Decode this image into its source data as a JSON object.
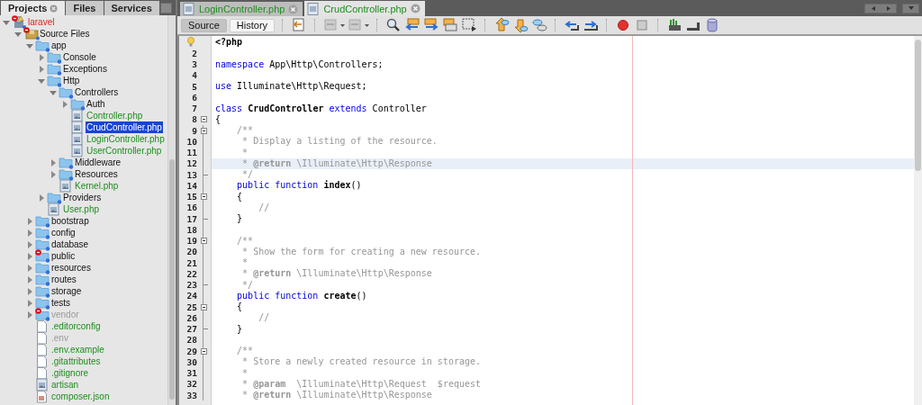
{
  "projects_panel": {
    "tabs": [
      {
        "label": "Projects",
        "selected": true
      },
      {
        "label": "Files",
        "selected": false
      },
      {
        "label": "Services",
        "selected": false
      }
    ],
    "tree": [
      {
        "label": "laravel",
        "kind": "project",
        "expanded": true,
        "error": true,
        "selected": false,
        "children": [
          {
            "label": "Source Files",
            "kind": "package",
            "expanded": true,
            "error": true,
            "added": false,
            "ignored": false,
            "selected": false,
            "children": [
              {
                "label": "app",
                "kind": "folder",
                "expanded": true,
                "error": false,
                "added": false,
                "ignored": false,
                "selected": false,
                "children": [
                  {
                    "label": "Console",
                    "kind": "folder",
                    "expanded": false,
                    "error": false,
                    "added": false,
                    "ignored": false,
                    "selected": false
                  },
                  {
                    "label": "Exceptions",
                    "kind": "folder",
                    "expanded": false,
                    "error": false,
                    "added": false,
                    "ignored": false,
                    "selected": false
                  },
                  {
                    "label": "Http",
                    "kind": "folder",
                    "expanded": true,
                    "error": false,
                    "added": false,
                    "ignored": false,
                    "selected": false,
                    "children": [
                      {
                        "label": "Controllers",
                        "kind": "folder",
                        "expanded": true,
                        "error": false,
                        "added": false,
                        "ignored": false,
                        "selected": false,
                        "children": [
                          {
                            "label": "Auth",
                            "kind": "folder",
                            "expanded": false,
                            "error": false,
                            "added": false,
                            "ignored": false,
                            "selected": false
                          },
                          {
                            "label": "Controller.php",
                            "kind": "php",
                            "error": false,
                            "added": true,
                            "ignored": false,
                            "selected": false
                          },
                          {
                            "label": "CrudController.php",
                            "kind": "php",
                            "error": false,
                            "added": true,
                            "ignored": false,
                            "selected": true
                          },
                          {
                            "label": "LoginController.php",
                            "kind": "php",
                            "error": false,
                            "added": true,
                            "ignored": false,
                            "selected": false
                          },
                          {
                            "label": "UserController.php",
                            "kind": "php",
                            "error": false,
                            "added": true,
                            "ignored": false,
                            "selected": false
                          }
                        ]
                      },
                      {
                        "label": "Middleware",
                        "kind": "folder",
                        "expanded": false,
                        "error": false,
                        "added": false,
                        "ignored": false,
                        "selected": false
                      },
                      {
                        "label": "Resources",
                        "kind": "folder",
                        "expanded": false,
                        "error": false,
                        "added": false,
                        "ignored": false,
                        "selected": false
                      },
                      {
                        "label": "Kernel.php",
                        "kind": "php",
                        "error": false,
                        "added": true,
                        "ignored": false,
                        "selected": false
                      }
                    ]
                  },
                  {
                    "label": "Providers",
                    "kind": "folder",
                    "expanded": false,
                    "error": false,
                    "added": false,
                    "ignored": false,
                    "selected": false
                  },
                  {
                    "label": "User.php",
                    "kind": "php",
                    "error": false,
                    "added": true,
                    "ignored": false,
                    "selected": false
                  }
                ]
              },
              {
                "label": "bootstrap",
                "kind": "folder",
                "expanded": false,
                "error": false,
                "added": false,
                "ignored": false,
                "selected": false
              },
              {
                "label": "config",
                "kind": "folder",
                "expanded": false,
                "error": false,
                "added": false,
                "ignored": false,
                "selected": false
              },
              {
                "label": "database",
                "kind": "folder",
                "expanded": false,
                "error": false,
                "added": false,
                "ignored": false,
                "selected": false
              },
              {
                "label": "public",
                "kind": "folder",
                "expanded": false,
                "error": true,
                "added": false,
                "ignored": false,
                "selected": false
              },
              {
                "label": "resources",
                "kind": "folder",
                "expanded": false,
                "error": false,
                "added": false,
                "ignored": false,
                "selected": false
              },
              {
                "label": "routes",
                "kind": "folder",
                "expanded": false,
                "error": false,
                "added": false,
                "ignored": false,
                "selected": false
              },
              {
                "label": "storage",
                "kind": "folder",
                "expanded": false,
                "error": false,
                "added": false,
                "ignored": false,
                "selected": false
              },
              {
                "label": "tests",
                "kind": "folder",
                "expanded": false,
                "error": false,
                "added": false,
                "ignored": false,
                "selected": false
              },
              {
                "label": "vendor",
                "kind": "folder",
                "expanded": false,
                "error": true,
                "added": false,
                "ignored": true,
                "selected": false
              },
              {
                "label": ".editorconfig",
                "kind": "text",
                "error": false,
                "added": true,
                "ignored": false,
                "selected": false
              },
              {
                "label": ".env",
                "kind": "text",
                "error": false,
                "added": false,
                "ignored": true,
                "selected": false
              },
              {
                "label": ".env.example",
                "kind": "text",
                "error": false,
                "added": true,
                "ignored": false,
                "selected": false
              },
              {
                "label": ".gitattributes",
                "kind": "text",
                "error": false,
                "added": true,
                "ignored": false,
                "selected": false
              },
              {
                "label": ".gitignore",
                "kind": "text",
                "error": false,
                "added": true,
                "ignored": false,
                "selected": false
              },
              {
                "label": "artisan",
                "kind": "php",
                "error": false,
                "added": true,
                "ignored": false,
                "selected": false
              },
              {
                "label": "composer.json",
                "kind": "json",
                "error": false,
                "added": true,
                "ignored": false,
                "selected": false
              }
            ]
          }
        ]
      }
    ]
  },
  "editor": {
    "tabs": [
      {
        "label": "LoginController.php",
        "selected": false
      },
      {
        "label": "CrudController.php",
        "selected": true
      }
    ],
    "view_buttons": [
      {
        "label": "Source",
        "selected": true
      },
      {
        "label": "History",
        "selected": false
      }
    ],
    "lines": [
      {
        "kind": "hint",
        "fold_start": false,
        "fold_end": false,
        "highlighted": false,
        "tokens": [
          {
            "text": "<?php",
            "kind": "bold"
          }
        ]
      },
      {
        "kind": "number",
        "number": "2",
        "fold_start": false,
        "fold_end": false,
        "highlighted": false
      },
      {
        "kind": "number",
        "number": "3",
        "fold_start": false,
        "fold_end": false,
        "highlighted": false,
        "tokens": [
          {
            "text": "namespace",
            "kind": "keyword"
          },
          {
            "text": " App\\Http\\Controllers;",
            "kind": "plain"
          }
        ]
      },
      {
        "kind": "number",
        "number": "4",
        "fold_start": false,
        "fold_end": false,
        "highlighted": false
      },
      {
        "kind": "number",
        "number": "5",
        "fold_start": false,
        "fold_end": false,
        "highlighted": false,
        "tokens": [
          {
            "text": "use",
            "kind": "keyword"
          },
          {
            "text": " Illuminate\\Http\\Request;",
            "kind": "plain"
          }
        ]
      },
      {
        "kind": "number",
        "number": "6",
        "fold_start": false,
        "fold_end": false,
        "highlighted": false
      },
      {
        "kind": "number",
        "number": "7",
        "fold_start": false,
        "fold_end": false,
        "highlighted": false,
        "tokens": [
          {
            "text": "class",
            "kind": "keyword"
          },
          {
            "text": " CrudController",
            "kind": "bold"
          },
          {
            "text": " extends",
            "kind": "keyword"
          },
          {
            "text": " Controller",
            "kind": "plain"
          }
        ]
      },
      {
        "kind": "number",
        "number": "8",
        "fold_start": true,
        "fold_end": false,
        "highlighted": false,
        "tokens": [
          {
            "text": "{",
            "kind": "plain"
          }
        ]
      },
      {
        "kind": "number",
        "number": "9",
        "fold_start": true,
        "fold_end": false,
        "highlighted": false,
        "tokens": [
          {
            "text": "    /**",
            "kind": "comment"
          }
        ]
      },
      {
        "kind": "number",
        "number": "10",
        "fold_start": false,
        "fold_end": false,
        "highlighted": false,
        "tokens": [
          {
            "text": "     * Display a listing of the resource.",
            "kind": "comment"
          }
        ]
      },
      {
        "kind": "number",
        "number": "11",
        "fold_start": false,
        "fold_end": false,
        "highlighted": false,
        "tokens": [
          {
            "text": "     *",
            "kind": "comment"
          }
        ]
      },
      {
        "kind": "number",
        "number": "12",
        "fold_start": false,
        "fold_end": false,
        "highlighted": true,
        "tokens": [
          {
            "text": "     *",
            "kind": "comment"
          },
          {
            "text": " @return",
            "kind": "tag"
          },
          {
            "text": " \\Illuminate\\Http\\Response",
            "kind": "comment"
          }
        ]
      },
      {
        "kind": "number",
        "number": "13",
        "fold_start": false,
        "fold_end": true,
        "highlighted": false,
        "tokens": [
          {
            "text": "     */",
            "kind": "comment"
          }
        ]
      },
      {
        "kind": "number",
        "number": "14",
        "fold_start": false,
        "fold_end": false,
        "highlighted": false,
        "tokens": [
          {
            "text": "    public function",
            "kind": "keyword"
          },
          {
            "text": " index",
            "kind": "bold"
          },
          {
            "text": "()",
            "kind": "plain"
          }
        ]
      },
      {
        "kind": "number",
        "number": "15",
        "fold_start": true,
        "fold_end": false,
        "highlighted": false,
        "tokens": [
          {
            "text": "    {",
            "kind": "plain"
          }
        ]
      },
      {
        "kind": "number",
        "number": "16",
        "fold_start": false,
        "fold_end": false,
        "highlighted": false,
        "tokens": [
          {
            "text": "        //",
            "kind": "comment"
          }
        ]
      },
      {
        "kind": "number",
        "number": "17",
        "fold_start": false,
        "fold_end": true,
        "highlighted": false,
        "tokens": [
          {
            "text": "    }",
            "kind": "plain"
          }
        ]
      },
      {
        "kind": "number",
        "number": "18",
        "fold_start": false,
        "fold_end": false,
        "highlighted": false
      },
      {
        "kind": "number",
        "number": "19",
        "fold_start": true,
        "fold_end": false,
        "highlighted": false,
        "tokens": [
          {
            "text": "    /**",
            "kind": "comment"
          }
        ]
      },
      {
        "kind": "number",
        "number": "20",
        "fold_start": false,
        "fold_end": false,
        "highlighted": false,
        "tokens": [
          {
            "text": "     * Show the form for creating a new resource.",
            "kind": "comment"
          }
        ]
      },
      {
        "kind": "number",
        "number": "21",
        "fold_start": false,
        "fold_end": false,
        "highlighted": false,
        "tokens": [
          {
            "text": "     *",
            "kind": "comment"
          }
        ]
      },
      {
        "kind": "number",
        "number": "22",
        "fold_start": false,
        "fold_end": false,
        "highlighted": false,
        "tokens": [
          {
            "text": "     *",
            "kind": "comment"
          },
          {
            "text": " @return",
            "kind": "tag"
          },
          {
            "text": " \\Illuminate\\Http\\Response",
            "kind": "comment"
          }
        ]
      },
      {
        "kind": "number",
        "number": "23",
        "fold_start": false,
        "fold_end": true,
        "highlighted": false,
        "tokens": [
          {
            "text": "     */",
            "kind": "comment"
          }
        ]
      },
      {
        "kind": "number",
        "number": "24",
        "fold_start": false,
        "fold_end": false,
        "highlighted": false,
        "tokens": [
          {
            "text": "    public function",
            "kind": "keyword"
          },
          {
            "text": " create",
            "kind": "bold"
          },
          {
            "text": "()",
            "kind": "plain"
          }
        ]
      },
      {
        "kind": "number",
        "number": "25",
        "fold_start": true,
        "fold_end": false,
        "highlighted": false,
        "tokens": [
          {
            "text": "    {",
            "kind": "plain"
          }
        ]
      },
      {
        "kind": "number",
        "number": "26",
        "fold_start": false,
        "fold_end": false,
        "highlighted": false,
        "tokens": [
          {
            "text": "        //",
            "kind": "comment"
          }
        ]
      },
      {
        "kind": "number",
        "number": "27",
        "fold_start": false,
        "fold_end": true,
        "highlighted": false,
        "tokens": [
          {
            "text": "    }",
            "kind": "plain"
          }
        ]
      },
      {
        "kind": "number",
        "number": "28",
        "fold_start": false,
        "fold_end": false,
        "highlighted": false
      },
      {
        "kind": "number",
        "number": "29",
        "fold_start": true,
        "fold_end": false,
        "highlighted": false,
        "tokens": [
          {
            "text": "    /**",
            "kind": "comment"
          }
        ]
      },
      {
        "kind": "number",
        "number": "30",
        "fold_start": false,
        "fold_end": false,
        "highlighted": false,
        "tokens": [
          {
            "text": "     * Store a newly created resource in storage.",
            "kind": "comment"
          }
        ]
      },
      {
        "kind": "number",
        "number": "31",
        "fold_start": false,
        "fold_end": false,
        "highlighted": false,
        "tokens": [
          {
            "text": "     *",
            "kind": "comment"
          }
        ]
      },
      {
        "kind": "number",
        "number": "32",
        "fold_start": false,
        "fold_end": false,
        "highlighted": false,
        "tokens": [
          {
            "text": "     *",
            "kind": "comment"
          },
          {
            "text": " @param",
            "kind": "tag"
          },
          {
            "text": "  \\Illuminate\\Http\\Request  $request",
            "kind": "comment"
          }
        ]
      },
      {
        "kind": "number",
        "number": "33",
        "fold_start": false,
        "fold_end": false,
        "highlighted": false,
        "tokens": [
          {
            "text": "     *",
            "kind": "comment"
          },
          {
            "text": " @return",
            "kind": "tag"
          },
          {
            "text": " \\Illuminate\\Http\\Response",
            "kind": "comment"
          }
        ]
      }
    ]
  }
}
